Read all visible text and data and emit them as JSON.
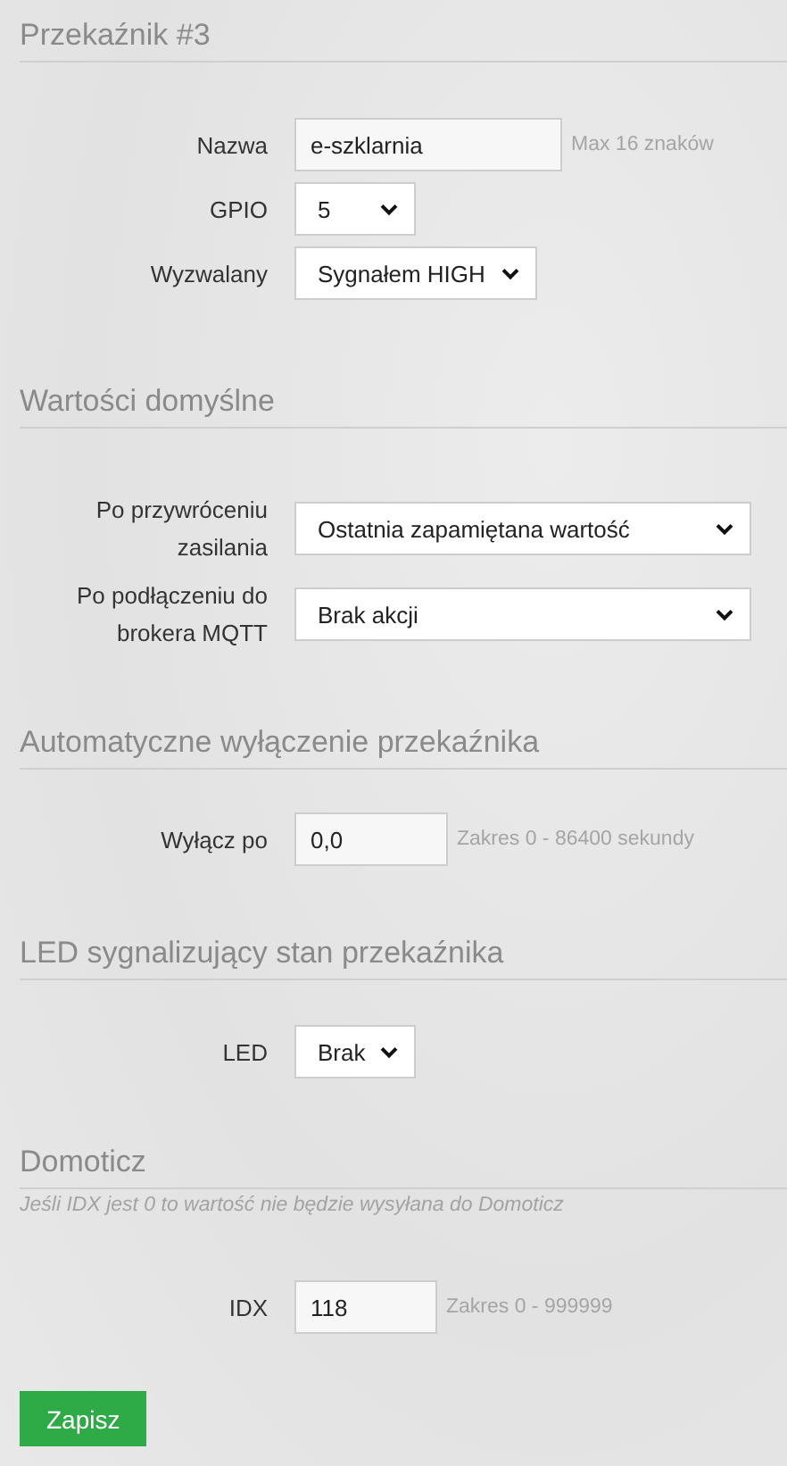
{
  "sections": [
    {
      "title": "Przekaźnik #3",
      "fields": [
        {
          "label": "Nazwa",
          "kind": "input",
          "value": "e-szklarnia",
          "hint": "Max 16 znaków"
        },
        {
          "label": "GPIO",
          "kind": "select",
          "value": "5"
        },
        {
          "label": "Wyzwalany",
          "kind": "select",
          "value": "Sygnałem HIGH"
        }
      ]
    },
    {
      "title": "Wartości domyślne",
      "fields": [
        {
          "label": "Po przywróceniu zasilania",
          "kind": "select",
          "value": "Ostatnia zapamiętana wartość"
        },
        {
          "label": "Po podłączeniu do brokera MQTT",
          "kind": "select",
          "value": "Brak akcji"
        }
      ]
    },
    {
      "title": "Automatyczne wyłączenie przekaźnika",
      "fields": [
        {
          "label": "Wyłącz po",
          "kind": "input",
          "value": "0,0",
          "hint": "Zakres 0 - 86400 sekundy"
        }
      ]
    },
    {
      "title": "LED sygnalizujący stan przekaźnika",
      "fields": [
        {
          "label": "LED",
          "kind": "select",
          "value": "Brak"
        }
      ]
    },
    {
      "title": "Domoticz",
      "note": "Jeśli IDX jest 0 to wartość nie będzie wysyłana do Domoticz",
      "fields": [
        {
          "label": "IDX",
          "kind": "input",
          "value": "118",
          "hint": "Zakres 0 - 999999"
        }
      ]
    }
  ],
  "save_button": "Zapisz"
}
